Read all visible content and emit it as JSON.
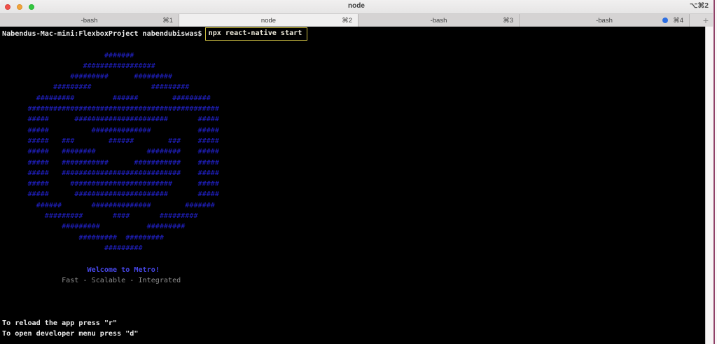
{
  "window": {
    "title": "node",
    "title_shortcut": "⌥⌘2"
  },
  "tabs": [
    {
      "label": "-bash",
      "shortcut": "⌘1"
    },
    {
      "label": "node",
      "shortcut": "⌘2"
    },
    {
      "label": "-bash",
      "shortcut": "⌘3"
    },
    {
      "label": "-bash",
      "shortcut": "⌘4"
    }
  ],
  "new_tab_label": "+",
  "terminal": {
    "prompt": "Nabendus-Mac-mini:FlexboxProject nabendubiswas$",
    "command": "npx react-native start",
    "logo_lines": [
      "                        #######",
      "                   #################",
      "                #########      #########",
      "            #########              #########",
      "        #########         ######        #########",
      "      #############################################",
      "      #####      ######################       #####",
      "      #####          ##############           #####",
      "      #####   ###        ######        ###    #####",
      "      #####   ########            ########    #####",
      "      #####   ###########      ###########    #####",
      "      #####   ############################    #####",
      "      #####     ########################      #####",
      "      #####      ######################       #####",
      "        ######       ##############        #######",
      "          #########       ####       #########",
      "              #########           #########",
      "                  #########  #########",
      "                        #########"
    ],
    "welcome": "                    Welcome to Metro!",
    "tagline": "              Fast - Scalable - Integrated",
    "hint_reload": "To reload the app press \"r\"",
    "hint_devmenu": "To open developer menu press \"d\""
  },
  "colors": {
    "logo_blue": "#2121c8",
    "welcome_blue": "#4646e6",
    "tagline_gray": "#8b8b8b",
    "terminal_text": "#ebebeb",
    "highlight_box_yellow": "#c9ba41",
    "activity_dot_blue": "#2d6fe3",
    "background_window_edge": "#8f4168"
  }
}
